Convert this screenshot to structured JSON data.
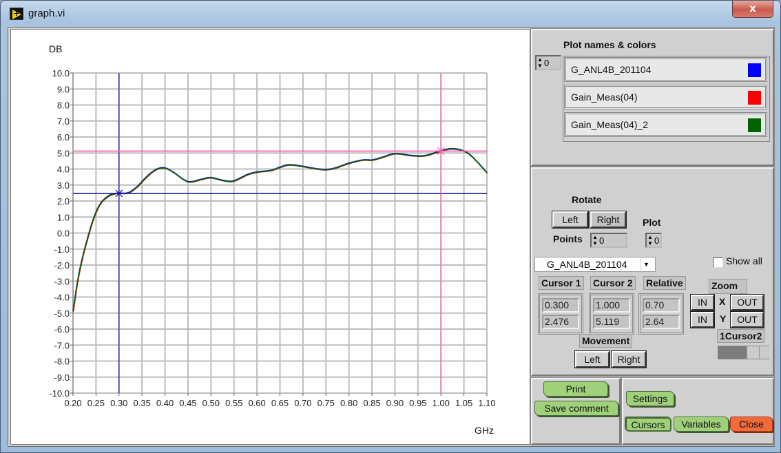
{
  "window": {
    "title": "graph.vi",
    "close_glyph": "x",
    "app_icon": "labview-vi-icon"
  },
  "chart_data": {
    "type": "line",
    "title": "",
    "xlabel": "GHz",
    "ylabel": "DB",
    "xlim": [
      0.2,
      1.1
    ],
    "ylim": [
      -10.0,
      10.0
    ],
    "grid": true,
    "x_ticks": [
      "0.20",
      "0.25",
      "0.30",
      "0.35",
      "0.40",
      "0.45",
      "0.50",
      "0.55",
      "0.60",
      "0.65",
      "0.70",
      "0.75",
      "0.80",
      "0.85",
      "0.90",
      "0.95",
      "1.00",
      "1.05",
      "1.10"
    ],
    "y_ticks": [
      "10.0",
      "9.0",
      "8.0",
      "7.0",
      "6.0",
      "5.0",
      "4.0",
      "3.0",
      "2.0",
      "1.0",
      "0.0",
      "-1.0",
      "-2.0",
      "-3.0",
      "-4.0",
      "-5.0",
      "-6.0",
      "-7.0",
      "-8.0",
      "-9.0",
      "-10.0"
    ],
    "x": [
      0.2,
      0.21,
      0.22,
      0.23,
      0.24,
      0.25,
      0.26,
      0.27,
      0.28,
      0.29,
      0.3,
      0.32,
      0.34,
      0.36,
      0.38,
      0.4,
      0.42,
      0.45,
      0.48,
      0.5,
      0.53,
      0.55,
      0.58,
      0.6,
      0.63,
      0.65,
      0.67,
      0.7,
      0.73,
      0.75,
      0.77,
      0.8,
      0.83,
      0.85,
      0.87,
      0.9,
      0.93,
      0.95,
      0.97,
      1.0,
      1.02,
      1.04,
      1.06,
      1.08,
      1.1
    ],
    "series": [
      {
        "name": "G_ANL4B_201104",
        "color": "#0000ff",
        "values": [
          -4.9,
          -3.0,
          -1.6,
          -0.5,
          0.5,
          1.3,
          1.85,
          2.15,
          2.35,
          2.45,
          2.476,
          2.5,
          2.9,
          3.5,
          3.95,
          4.05,
          3.75,
          3.2,
          3.35,
          3.45,
          3.25,
          3.25,
          3.65,
          3.8,
          3.9,
          4.1,
          4.25,
          4.15,
          4.0,
          3.95,
          4.05,
          4.35,
          4.55,
          4.55,
          4.7,
          4.95,
          4.85,
          4.8,
          4.85,
          5.119,
          5.25,
          5.2,
          4.95,
          4.4,
          3.75
        ]
      },
      {
        "name": "Gain_Meas(04)",
        "color": "#ff0000",
        "values": [
          -4.9,
          -3.0,
          -1.6,
          -0.5,
          0.5,
          1.3,
          1.85,
          2.15,
          2.35,
          2.45,
          2.476,
          2.5,
          2.9,
          3.5,
          3.95,
          4.05,
          3.75,
          3.2,
          3.35,
          3.45,
          3.25,
          3.25,
          3.65,
          3.8,
          3.9,
          4.1,
          4.25,
          4.15,
          4.0,
          3.95,
          4.05,
          4.35,
          4.55,
          4.55,
          4.7,
          4.95,
          4.85,
          4.8,
          4.85,
          5.119,
          5.25,
          5.2,
          4.95,
          4.4,
          3.75
        ]
      },
      {
        "name": "Gain_Meas(04)_2",
        "color": "#006400",
        "values": [
          -4.9,
          -3.0,
          -1.6,
          -0.5,
          0.5,
          1.3,
          1.85,
          2.15,
          2.35,
          2.45,
          2.476,
          2.5,
          2.9,
          3.5,
          3.95,
          4.05,
          3.75,
          3.2,
          3.35,
          3.45,
          3.25,
          3.25,
          3.65,
          3.8,
          3.9,
          4.1,
          4.25,
          4.15,
          4.0,
          3.95,
          4.05,
          4.35,
          4.55,
          4.55,
          4.7,
          4.95,
          4.85,
          4.8,
          4.85,
          5.119,
          5.25,
          5.2,
          4.95,
          4.4,
          3.75
        ]
      }
    ],
    "cursors": [
      {
        "name": "Cursor 1",
        "x": 0.3,
        "y": 2.476,
        "color": "#1a1aa0"
      },
      {
        "name": "Cursor 2",
        "x": 1.0,
        "y": 5.119,
        "color": "#ff55aa"
      }
    ]
  },
  "plot_legend": {
    "title": "Plot names & colors",
    "index_value": "0",
    "items": [
      {
        "name": "G_ANL4B_201104",
        "color": "#0000ff"
      },
      {
        "name": "Gain_Meas(04)",
        "color": "#ff0000"
      },
      {
        "name": "Gain_Meas(04)_2",
        "color": "#006400"
      }
    ]
  },
  "rotate": {
    "label": "Rotate",
    "left_label": "Left",
    "right_label": "Right",
    "points_label": "Points",
    "points_value": "0",
    "plot_label": "Plot",
    "plot_value": "0"
  },
  "plot_select": {
    "selected": "G_ANL4B_201104"
  },
  "show_all": {
    "label": "Show all",
    "checked": false
  },
  "cursor_panel": {
    "cursor1_label": "Cursor 1",
    "cursor2_label": "Cursor 2",
    "relative_label": "Relative",
    "cursor1_x": "0.300",
    "cursor1_y": "2.476",
    "cursor2_x": "1.000",
    "cursor2_y": "5.119",
    "relative_x": "0.70",
    "relative_y": "2.64",
    "movement_label": "Movement",
    "move_left_label": "Left",
    "move_right_label": "Right"
  },
  "zoom": {
    "label": "Zoom",
    "x_axis_label": "X",
    "y_axis_label": "Y",
    "in_label": "IN",
    "out_label": "OUT",
    "cursor_select_label": "1Cursor2",
    "cursor_select_fraction": 0.55
  },
  "actions": {
    "print_label": "Print",
    "save_comment_label": "Save comment",
    "settings_label": "Settings",
    "cursors_label": "Cursors",
    "variables_label": "Variables",
    "close_label": "Close"
  }
}
